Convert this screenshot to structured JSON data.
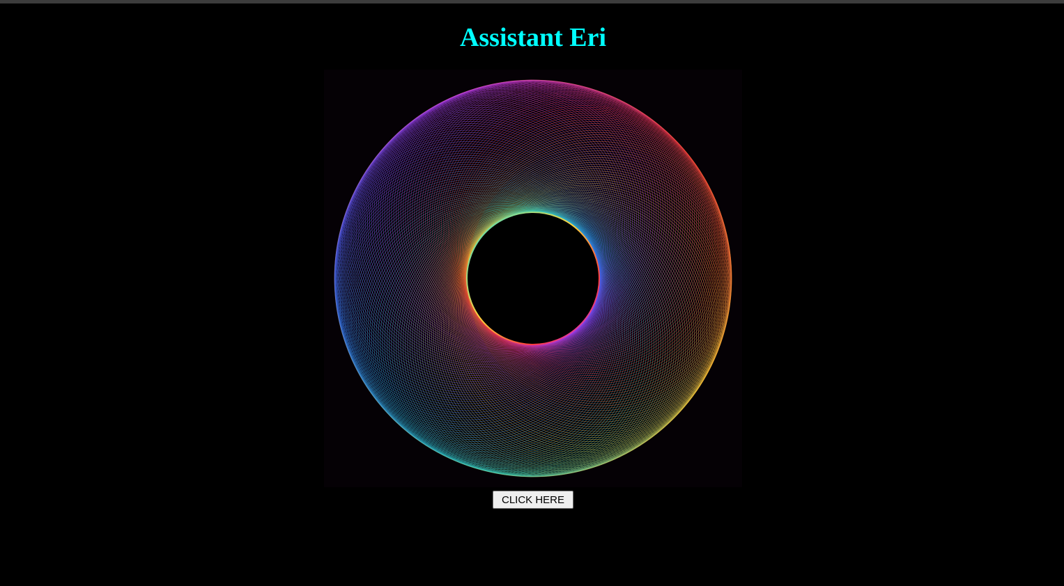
{
  "header": {
    "title": "Assistant Eri",
    "title_color": "#00ffff"
  },
  "visual": {
    "description_icon": "rainbow-torus-animation",
    "background_color": "#050105",
    "palette": [
      "#ff3b3b",
      "#ffd23b",
      "#2fe0d0",
      "#3b6cff",
      "#c03bff"
    ]
  },
  "action": {
    "button_label": "CLICK HERE"
  }
}
